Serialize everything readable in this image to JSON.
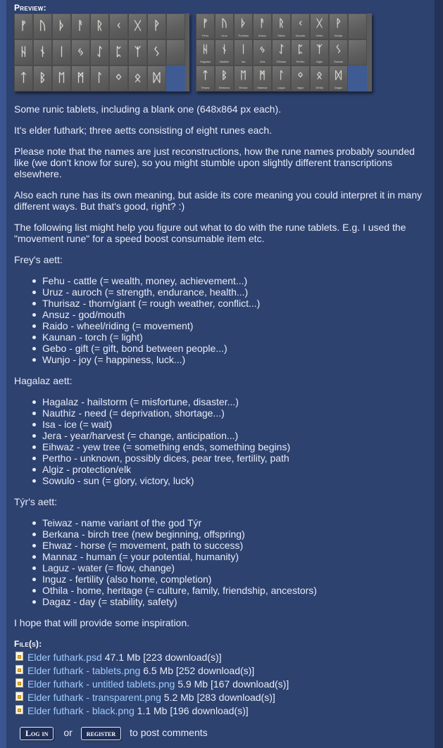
{
  "preview_label": "Preview:",
  "tablet_plain": {
    "runes": [
      "ᚠ",
      "ᚢ",
      "ᚦ",
      "ᚨ",
      "ᚱ",
      "ᚲ",
      "ᚷ",
      "ᚹ",
      "",
      "ᚺ",
      "ᚾ",
      "ᛁ",
      "ᛃ",
      "ᛇ",
      "ᛈ",
      "ᛉ",
      "ᛊ",
      "",
      "ᛏ",
      "ᛒ",
      "ᛖ",
      "ᛗ",
      "ᛚ",
      "ᛜ",
      "ᛟ",
      "ᛞ",
      ""
    ]
  },
  "tablet_named": {
    "runes": [
      "ᚠ",
      "ᚢ",
      "ᚦ",
      "ᚨ",
      "ᚱ",
      "ᚲ",
      "ᚷ",
      "ᚹ",
      "",
      "ᚺ",
      "ᚾ",
      "ᛁ",
      "ᛃ",
      "ᛇ",
      "ᛈ",
      "ᛉ",
      "ᛊ",
      "",
      "ᛏ",
      "ᛒ",
      "ᛖ",
      "ᛗ",
      "ᛚ",
      "ᛜ",
      "ᛟ",
      "ᛞ",
      ""
    ],
    "names": [
      "Fehu",
      "Uruz",
      "Thurisaz",
      "Ansuz",
      "Raido",
      "Kaunan",
      "Gebo",
      "Wunjo",
      "",
      "Hagalaz",
      "Nauthiz",
      "Isa",
      "Jera",
      "Eihwaz",
      "Pertho",
      "Algiz",
      "Sowulo",
      "",
      "Teiwaz",
      "Berkana",
      "Ehwaz",
      "Mannaz",
      "Laguz",
      "Inguz",
      "Othila",
      "Dagaz",
      ""
    ]
  },
  "paragraphs": {
    "p1": "Some runic tablets, including a blank one (648x864 px each).",
    "p2": "It's elder futhark; three aetts consisting of eight runes each.",
    "p3": "Please note that the names are just reconstructions, how the rune names probably sounded like (we don't know for sure), so you might stumble upon slightly different transcriptions elsewhere.",
    "p4": "Also each rune has its own meaning, but aside its core meaning you could interpret it in many different ways. But that's good, right? :)",
    "p5": "The following list might help you figure out what to do with the rune tablets. E.g. I used the \"movement rune\" for a speed boost consumable item etc.",
    "closing": "I hope that will provide some inspiration."
  },
  "aetts": [
    {
      "heading": "Frey's aett:",
      "items": [
        "Fehu - cattle (= wealth, money, achievement...)",
        "Uruz - auroch (= strength, endurance, health...)",
        "Thurisaz - thorn/giant (= rough weather, conflict...)",
        "Ansuz - god/mouth",
        "Raido - wheel/riding (= movement)",
        "Kaunan - torch (= light)",
        "Gebo - gift (= gift, bond between people...)",
        "Wunjo - joy (= happiness, luck...)"
      ]
    },
    {
      "heading": "Hagalaz aett:",
      "items": [
        "Hagalaz - hailstorm (= misfortune, disaster...)",
        "Nauthiz - need (= deprivation, shortage...)",
        "Isa - ice (= wait)",
        "Jera - year/harvest (= change, anticipation...)",
        "Eihwaz - yew tree (= something ends, something begins)",
        "Pertho - unknown, possibly dices, pear tree, fertility, path",
        "Algiz - protection/elk",
        "Sowulo - sun (= glory, victory, luck)"
      ]
    },
    {
      "heading": "Týr's aett:",
      "items": [
        "Teiwaz - name variant of the god Týr",
        "Berkana - birch tree (new beginning, offspring)",
        "Ehwaz - horse (= movement, path to success)",
        "Mannaz - human (= your potential, humanity)",
        "Laguz - water (= flow, change)",
        "Inguz - fertility (also home, completion)",
        "Othila - home, heritage (= culture, family, friendship, ancestors)",
        "Dagaz - day (= stability, safety)"
      ]
    }
  ],
  "files_label": "File(s):",
  "files": [
    {
      "name": "Elder futhark.psd",
      "size": "47.1 Mb",
      "downloads": "[223 download(s)]"
    },
    {
      "name": "Elder futhark - tablets.png",
      "size": "6.5 Mb",
      "downloads": "[252 download(s)]"
    },
    {
      "name": "Elder futhark - untitled tablets.png",
      "size": "5.9 Mb",
      "downloads": "[167 download(s)]"
    },
    {
      "name": "Elder futhark - transparent.png",
      "size": "5.2 Mb",
      "downloads": "[283 download(s)]"
    },
    {
      "name": "Elder futhark - black.png",
      "size": "1.1 Mb",
      "downloads": "[196 download(s)]"
    }
  ],
  "auth": {
    "login_label": "Log in",
    "or_text": "or",
    "register_label": "register",
    "post_text": "to post comments"
  },
  "colors": {
    "background": "#2e4270",
    "link": "#9ecbff",
    "tablet_stone": "#6a6a6a",
    "blank_cell": "#3f5b93"
  }
}
